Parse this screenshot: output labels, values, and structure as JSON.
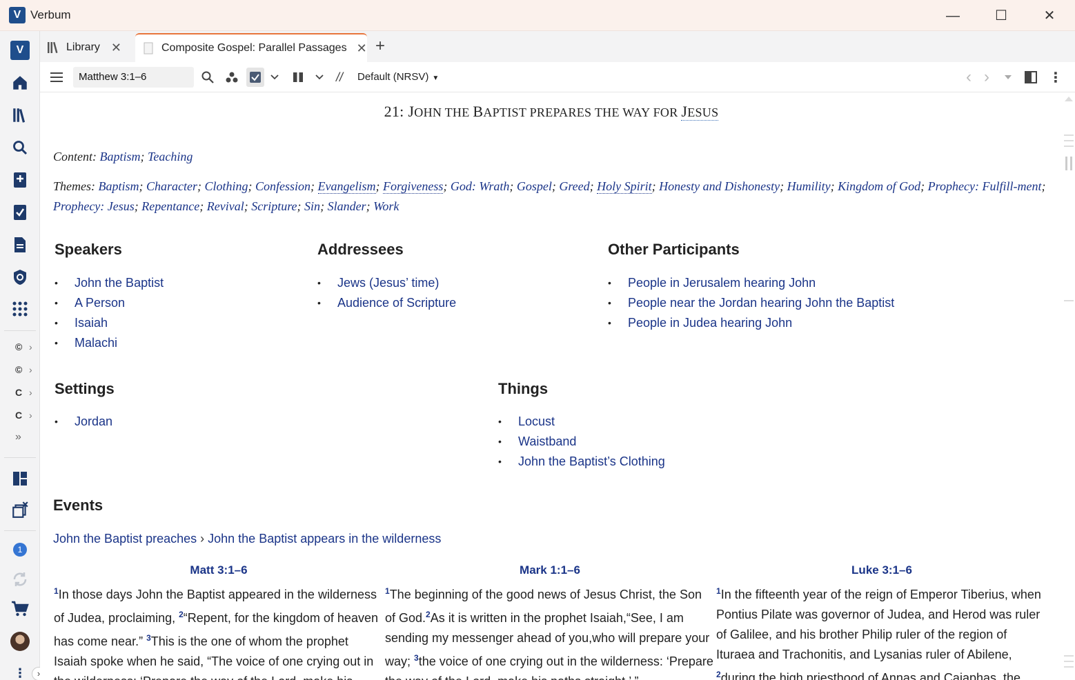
{
  "window": {
    "title": "Verbum",
    "minimize": "—",
    "maximize": "☐",
    "close": "✕"
  },
  "tabs": [
    {
      "label": "Library",
      "close": "✕"
    },
    {
      "label": "Composite Gospel: Parallel Passages",
      "close": "✕"
    }
  ],
  "add_tab": "+",
  "toolbar": {
    "reference": "Matthew 3:1–6",
    "version": "Default (NRSV)",
    "parallel_symbol": "//",
    "back_glyph": "‹",
    "forward_glyph": "›"
  },
  "rail": {
    "resource_marks": [
      "©",
      "©",
      "C",
      "C"
    ],
    "more": "»",
    "notification_count": "1"
  },
  "heading": {
    "number": "21: ",
    "p1_cap": "J",
    "p1_rest": "OHN THE ",
    "p2_cap": "B",
    "p2_rest": "APTIST PREPARES THE WAY FOR ",
    "p3_cap": "J",
    "p3_rest": "ESUS"
  },
  "content_line": {
    "label": "Content: ",
    "items": [
      "Baptism",
      "Teaching"
    ]
  },
  "themes": {
    "label": "Themes: ",
    "items": [
      "Baptism",
      "Character",
      "Clothing",
      "Confession",
      "Evangelism",
      "Forgiveness",
      "God: Wrath",
      "Gospel",
      "Greed",
      "Holy Spirit",
      "Honesty and Dishonesty",
      "Humility",
      "Kingdom of God",
      "Prophecy: Fulfill-ment",
      "Prophecy: Jesus",
      "Repentance",
      "Revival",
      "Scripture",
      "Sin",
      "Slander",
      "Work"
    ]
  },
  "speakers": {
    "title": "Speakers",
    "items": [
      "John the Baptist",
      "A Person",
      "Isaiah",
      "Malachi"
    ]
  },
  "addressees": {
    "title": "Addressees",
    "items": [
      "Jews (Jesus’ time)",
      "Audience of Scripture"
    ]
  },
  "other_participants": {
    "title": "Other Participants",
    "items": [
      "People in Jerusalem hearing John",
      "People near the Jordan hearing John the Baptist",
      "People in Judea hearing John"
    ]
  },
  "settings": {
    "title": "Settings",
    "items": [
      "Jordan"
    ]
  },
  "things": {
    "title": "Things",
    "items": [
      "Locust",
      "Waistband",
      "John the Baptist’s Clothing"
    ]
  },
  "events": {
    "title": "Events",
    "path_a": "John the Baptist preaches",
    "separator": " › ",
    "path_b": "John the Baptist appears in the wilderness"
  },
  "passages": [
    {
      "ref": "Matt 3:1–6",
      "verses": [
        {
          "n": "1",
          "t": "In those days John the Baptist appeared in the wilderness of Judea, proclaiming, "
        },
        {
          "n": "2",
          "t": "“Repent, for the kingdom of heaven has come near.” "
        },
        {
          "n": "3",
          "t": "This is the one of whom the prophet Isaiah spoke when he said, “The voice of one crying out in the wilderness: ‘Prepare the way of the Lord, make his"
        }
      ]
    },
    {
      "ref": "Mark 1:1–6",
      "verses": [
        {
          "n": "1",
          "t": "The beginning of the good news of Jesus Christ, the Son of God."
        },
        {
          "n": "2",
          "t": "As it is written in the prophet Isaiah,“See, I am sending my messenger ahead of you,who will prepare your way; "
        },
        {
          "n": "3",
          "t": "the voice of one crying out in the wilderness: ‘Prepare the way of the Lord, make his paths straight,’ ”"
        }
      ]
    },
    {
      "ref": "Luke 3:1–6",
      "verses": [
        {
          "n": "1",
          "t": "In the fifteenth year of the reign of Emperor Tiberius, when Pontius Pilate was governor of Judea, and Herod was ruler of Galilee, and his brother Philip ruler of the region of Ituraea and Trachonitis, and Lysanias ruler of Abilene, "
        },
        {
          "n": "2",
          "t": "during the high priesthood of Annas and Caiaphas, the"
        }
      ]
    }
  ]
}
